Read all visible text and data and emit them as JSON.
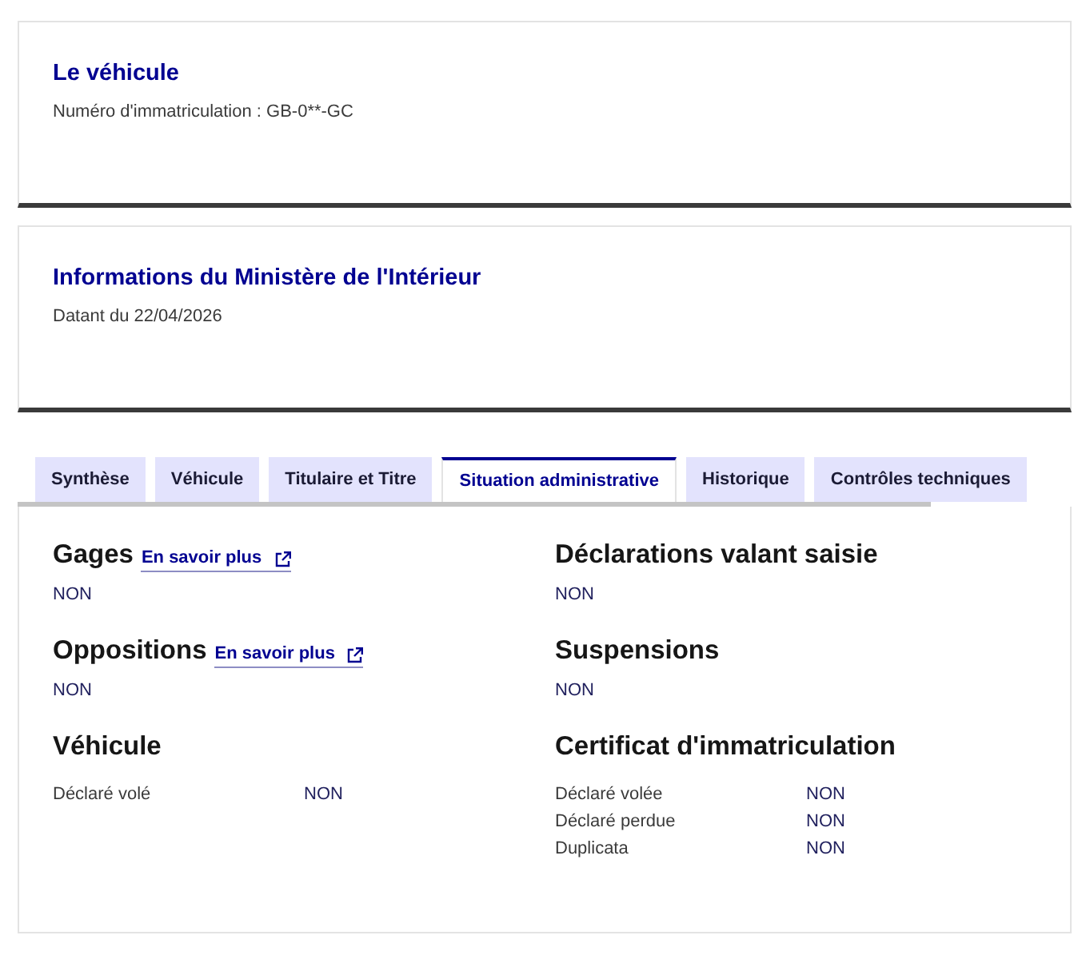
{
  "cards": [
    {
      "title": "Le véhicule",
      "text": "Numéro d'immatriculation : GB-0**-GC"
    },
    {
      "title": "Informations du Ministère de l'Intérieur",
      "text": "Datant du 22/04/2026"
    }
  ],
  "tabs": [
    {
      "label": "Synthèse",
      "selected": false
    },
    {
      "label": "Véhicule",
      "selected": false
    },
    {
      "label": "Titulaire et Titre",
      "selected": false
    },
    {
      "label": "Situation administrative",
      "selected": true
    },
    {
      "label": "Historique",
      "selected": false
    },
    {
      "label": "Contrôles techniques",
      "selected": false
    }
  ],
  "panel": {
    "columns": [
      [
        {
          "kind": "status",
          "title": "Gages",
          "link": "En savoir plus",
          "value": "NON"
        },
        {
          "kind": "status",
          "title": "Oppositions",
          "link": "En savoir plus",
          "value": "NON"
        },
        {
          "kind": "table",
          "title": "Véhicule",
          "rows": [
            {
              "label": "Déclaré volé",
              "value": "NON"
            }
          ]
        }
      ],
      [
        {
          "kind": "status",
          "title": "Déclarations valant saisie",
          "value": "NON"
        },
        {
          "kind": "status",
          "title": "Suspensions",
          "value": "NON"
        },
        {
          "kind": "table",
          "title": "Certificat d'immatriculation",
          "rows": [
            {
              "label": "Déclaré volée",
              "value": "NON"
            },
            {
              "label": "Déclaré perdue",
              "value": "NON"
            },
            {
              "label": "Duplicata",
              "value": "NON"
            }
          ]
        }
      ]
    ]
  }
}
